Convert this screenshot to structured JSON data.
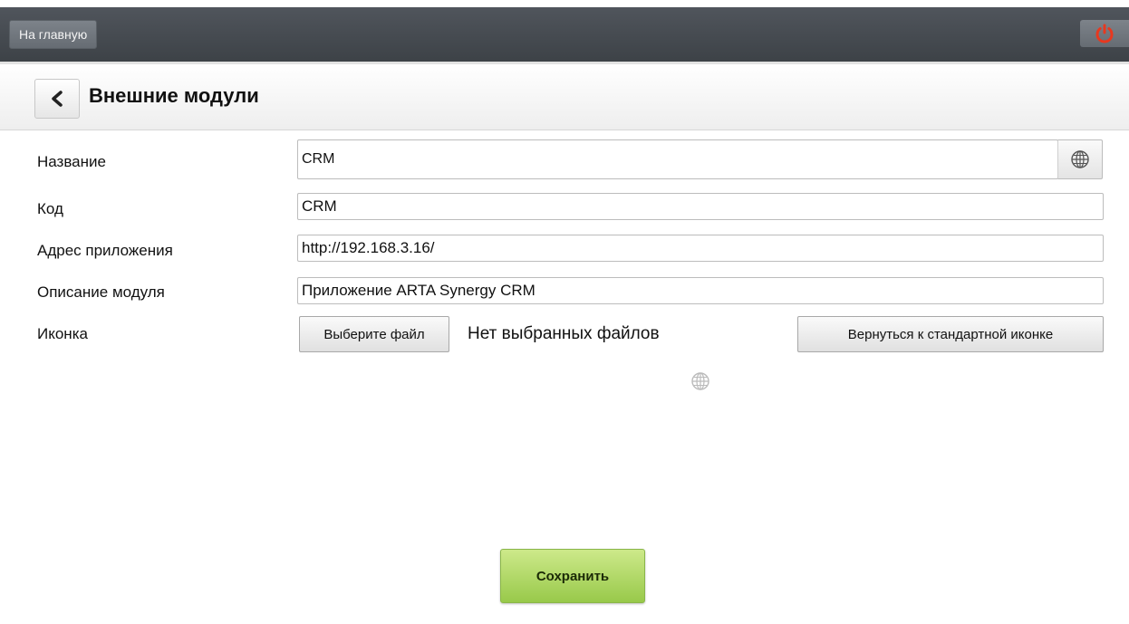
{
  "topbar": {
    "home_label": "На главную",
    "power_icon": "power-icon",
    "power_color": "#e8381f"
  },
  "header": {
    "back_icon": "chevron-left-icon",
    "title": "Внешние модули"
  },
  "form": {
    "name": {
      "label": "Название",
      "value": "CRM",
      "globe_icon": "globe-icon"
    },
    "code": {
      "label": "Код",
      "value": "CRM"
    },
    "address": {
      "label": "Адрес приложения",
      "value": "http://192.168.3.16/"
    },
    "description": {
      "label": "Описание модуля",
      "value": "Приложение ARTA Synergy CRM"
    },
    "icon": {
      "label": "Иконка",
      "choose_file_label": "Выберите файл",
      "no_file_text": "Нет выбранных файлов",
      "reset_label": "Вернуться к стандартной иконке",
      "preview_icon": "globe-icon"
    }
  },
  "actions": {
    "save_label": "Сохранить",
    "save_color": "#98c94a"
  }
}
